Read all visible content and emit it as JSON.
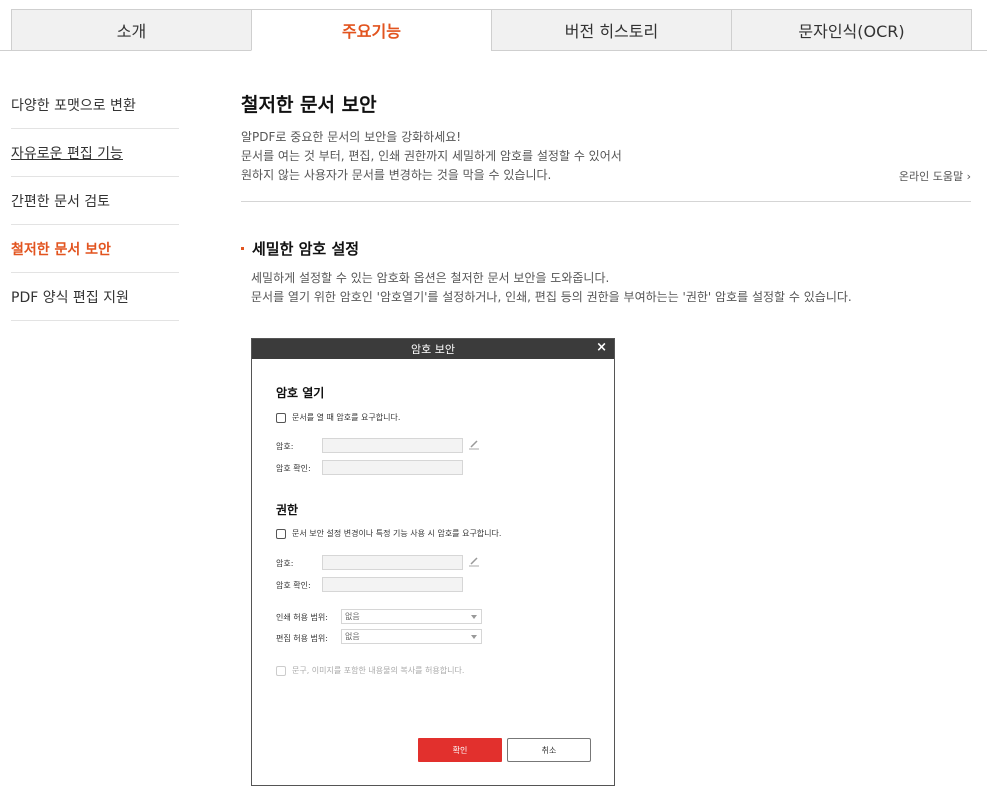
{
  "tabs": [
    {
      "label": "소개"
    },
    {
      "label": "주요기능"
    },
    {
      "label": "버전 히스토리"
    },
    {
      "label": "문자인식(OCR)"
    }
  ],
  "sidebar": {
    "items": [
      {
        "label": "다양한 포맷으로 변환"
      },
      {
        "label": "자유로운 편집 기능"
      },
      {
        "label": "간편한 문서 검토"
      },
      {
        "label": "철저한 문서 보안"
      },
      {
        "label": "PDF 양식 편집 지원"
      }
    ]
  },
  "main": {
    "title": "철저한 문서 보안",
    "intro": [
      "알PDF로 중요한 문서의 보안을 강화하세요!",
      "문서를 여는 것 부터, 편집, 인쇄 권한까지 세밀하게 암호를 설정할 수 있어서",
      "원하지 않는 사용자가 문서를 변경하는 것을 막을 수 있습니다."
    ],
    "help_link": "온라인 도움말 ›",
    "section_title": "세밀한 암호 설정",
    "section_desc": [
      "세밀하게 설정할 수 있는 암호화 옵션은 철저한 문서 보안을 도와줍니다.",
      "문서를 열기 위한 암호인 '암호열기'를 설정하거나, 인쇄, 편집 등의 권한을 부여하는는 '권한' 암호를 설정할 수 있습니다."
    ]
  },
  "dialog": {
    "title": "암호 보안",
    "close": "×",
    "open_section": {
      "title": "암호 열기",
      "checkbox": "문서를 열 때 암호를 요구합니다.",
      "password_label": "암호:",
      "confirm_label": "암호 확인:"
    },
    "perm_section": {
      "title": "권한",
      "checkbox": "문서 보안 설정 변경이나 특정 기능 사용 시 암호를 요구합니다.",
      "password_label": "암호:",
      "confirm_label": "암호 확인:",
      "print_label": "인쇄 허용 범위:",
      "print_value": "없음",
      "edit_label": "편집 허용 범위:",
      "edit_value": "없음",
      "copy_checkbox": "문구, 이미지를 포함한 내용물의 복사를 허용합니다."
    },
    "ok_label": "확인",
    "cancel_label": "취소"
  },
  "colors": {
    "accent": "#e2541f",
    "ok_button": "#e2302d",
    "title_bar": "#3b3b3b"
  }
}
